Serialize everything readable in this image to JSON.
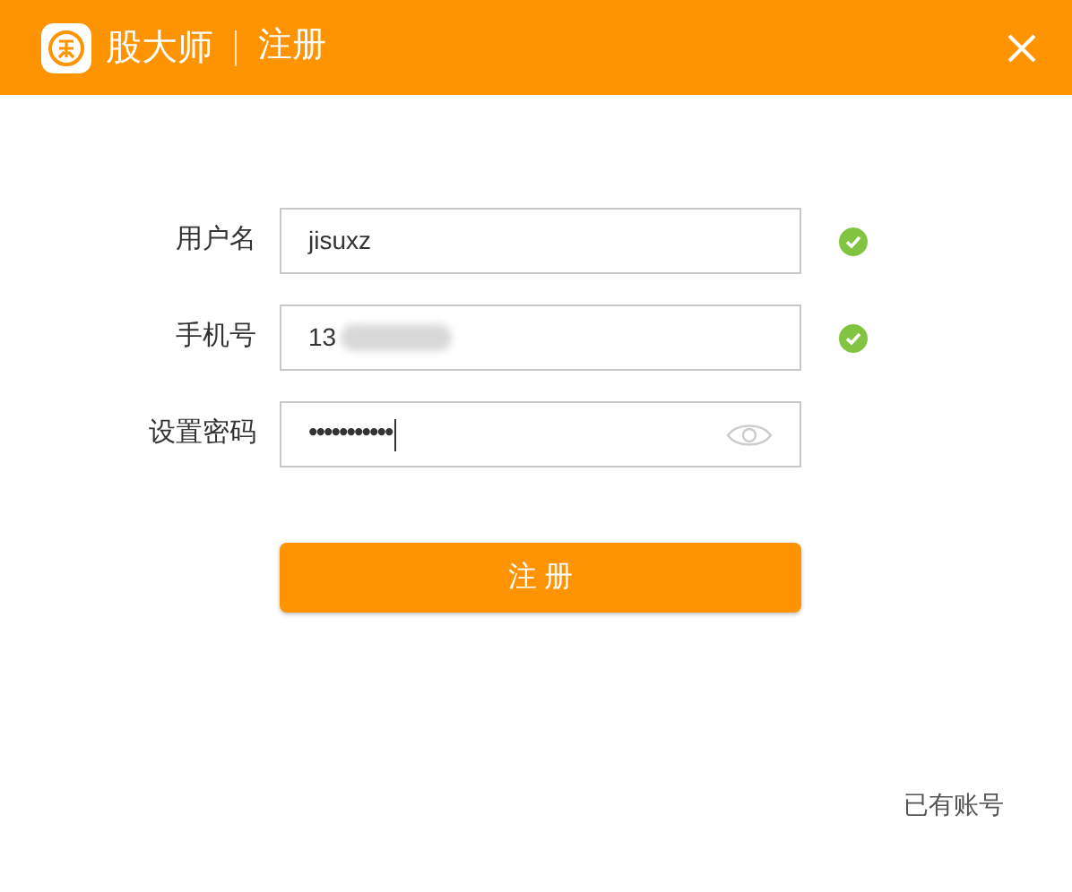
{
  "header": {
    "app_name": "股大师",
    "title": "注册"
  },
  "fields": [
    {
      "kind": "text",
      "label": "用户名",
      "value": "jisuxz",
      "valid": true
    },
    {
      "kind": "phone",
      "label": "手机号",
      "value": "13",
      "valid": true
    },
    {
      "kind": "password",
      "label": "设置密码",
      "value": "•••••••••••",
      "valid": false
    }
  ],
  "submit_button": "注 册",
  "login_link": "已有账号"
}
